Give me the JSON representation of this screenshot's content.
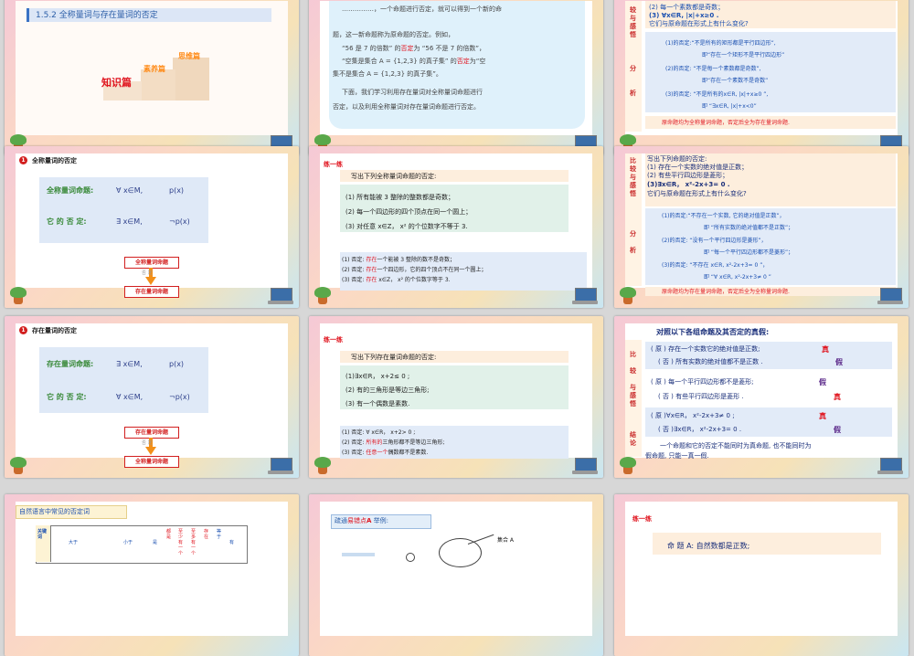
{
  "s1": {
    "title": "1.5.2  全称量词与存在量词的否定",
    "step1": "知识篇",
    "step2": "素养篇",
    "step3": "思维篇"
  },
  "s2": {
    "l1": "……………，一个命题进行否定，就可以得到一个新的命",
    "l2": "题，这一新命题称为原命题的否定。例如，",
    "l3a": "“56 是 7 的倍数” 的",
    "l3b": "否定",
    "l3c": "为 “56 不是 7 的倍数”，",
    "l4a": "“空集是集合 A = {1,2,3} 的真子集” 的",
    "l4b": "否定",
    "l4c": "为“空",
    "l5": "集不是集合 A = {1,2,3} 的真子集”。",
    "l6": "下面，我们学习利用存在量词对全称量词命题进行",
    "l7": "否定，以及利用全称量词对存在量词命题进行否定。"
  },
  "s3": {
    "side": [
      "较",
      "与",
      "感",
      "悟"
    ],
    "side2": [
      "分",
      "析"
    ],
    "top1": "(2) 每一个素数都是奇数；",
    "top2": "(3) ∀x∈R, |x|+x≥0 .",
    "top3": "它们与原命题在形式上有什么变化?",
    "a1": "(1)的否定:“不是所有的矩形都是平行四边形”,",
    "a2": "即“存在一个矩形不是平行四边形”",
    "a3": "(2)的否定: “不是每一个素数都是奇数”,",
    "a4": "即“存在一个素数不是奇数”",
    "a5": "(3)的否定: “不是所有的x∈R, |x|+x≥0 ”,",
    "a6": "即 “∃x∈R, |x|+x<0”",
    "foot": "原命题均为全称量词命题，否定后全为存在量词命题."
  },
  "s4": {
    "badge": "1",
    "title": "全称量词的否定",
    "row1a": "全称量词命题:",
    "row1b": "∀ x∈M,",
    "row1c": "p(x)",
    "row2a": "它 的 否 定:",
    "row2b": "∃ x∈M,",
    "row2c": "¬p(x)",
    "top": "全称量词命题",
    "mid": "否 定",
    "bot": "存在量词命题"
  },
  "s5": {
    "head": "练一练",
    "prompt": "写出下列全称量词命题的否定:",
    "q1": "(1) 所有能被 3 整除的整数都是奇数；",
    "q2": "(2) 每一个四边形的四个顶点在同一个圆上；",
    "q3": "(3) 对任意 x∈Z， x² 的个位数字不等于 3.",
    "a1a": "(1) 否定: ",
    "a1b": "存在",
    "a1c": "一个能被 3 整除的数不是奇数；",
    "a2a": "(2) 否定: ",
    "a2b": "存在",
    "a2c": "一个四边形，它的四个顶点不在同一个圆上；",
    "a3a": "(3) 否定: ",
    "a3b": "存在",
    "a3c": " x∈Z， x² 的个位数字等于 3."
  },
  "s6": {
    "side": [
      "比",
      "较",
      "与",
      "感",
      "悟"
    ],
    "side2": [
      "分",
      "析"
    ],
    "top0": "写出下列命题的否定:",
    "top1": "(1) 存在一个实数的绝对值是正数；",
    "top2": "(2) 有些平行四边形是菱形；",
    "top3": "(3)∃x∈R， x²-2x+3= 0 .",
    "top4": "它们与原命题在形式上有什么变化?",
    "a1": "(1)的否定:“不存在一个实数, 它的绝对值是正数”，",
    "a2": "即  “所有实数的绝对值都不是正数”；",
    "a3": "(2)的否定:  “没有一个平行四边形是菱形”，",
    "a4": "即 “每一个平行四边形都不是菱形”；",
    "a5": "(3)的否定:  “不存在 x∈R, x²-2x+3= 0 ”，",
    "a6": "即  “∀ x∈R, x²-2x+3≠ 0 ”",
    "foot": "原命题均为存在量词命题，否定后全为全称量词命题."
  },
  "s7": {
    "badge": "1",
    "title": "存在量词的否定",
    "row1a": "存在量词命题:",
    "row1b": "∃ x∈M,",
    "row1c": "p(x)",
    "row2a": "它 的 否 定:",
    "row2b": "∀ x∈M,",
    "row2c": "¬p(x)",
    "top": "存在量词命题",
    "mid": "否 定",
    "bot": "全称量词命题"
  },
  "s8": {
    "head": "练一练",
    "prompt": "写出下列存在量词命题的否定:",
    "q1": "(1)∃x∈R， x+2≤ 0 ;",
    "q2": "(2) 有的三角形是等边三角形;",
    "q3": "(3) 有一个偶数是素数.",
    "a1a": "(1) 否定: ∀ x∈R， x+2> 0 ;",
    "a2a": "(2) 否定: ",
    "a2b": "所有的",
    "a2c": "三角形都不是等边三角形;",
    "a3a": "(3) 否定: ",
    "a3b": "任意一个",
    "a3c": "偶数都不是素数."
  },
  "s9": {
    "title": "对照以下各组命题及其否定的真假:",
    "side": [
      "比",
      "较",
      "与",
      "感",
      "悟"
    ],
    "side2": [
      "结",
      "论"
    ],
    "p1": "( 原 ) 存在一个实数它的绝对值是正数;",
    "p1v": "真",
    "n1": "( 否 ) 所有实数的绝对值都不是正数 .",
    "n1v": "假",
    "p2": "( 原 ) 每一个平行四边形都不是菱形;",
    "p2v": "假",
    "n2": "( 否 ) 有些平行四边形是菱形 .",
    "n2v": "真",
    "p3": "( 原 )∀x∈R， x²-2x+3≠ 0 ;",
    "p3v": "真",
    "n3": "( 否 )∃x∈R， x²-2x+3= 0 .",
    "n3v": "假",
    "c1": "一个命题和它的否定不能同时为真命题, 也不能同时为",
    "c2": "假命题, 只能一真一假."
  },
  "s10": {
    "title": "自然语言中常见的否定词",
    "head": "关键词",
    "cols": [
      "大于",
      "小于",
      "是",
      "都是",
      "至少有一个",
      "至多有一个",
      "存在",
      "等于",
      "有"
    ]
  },
  "s11": {
    "title1": "疏通",
    "title2": "易错点",
    "title3": "A",
    "title4": "举例:",
    "label": "集合 A"
  },
  "s12": {
    "head": "练一练",
    "line": "命 题 A: 自然数都是正数;"
  }
}
